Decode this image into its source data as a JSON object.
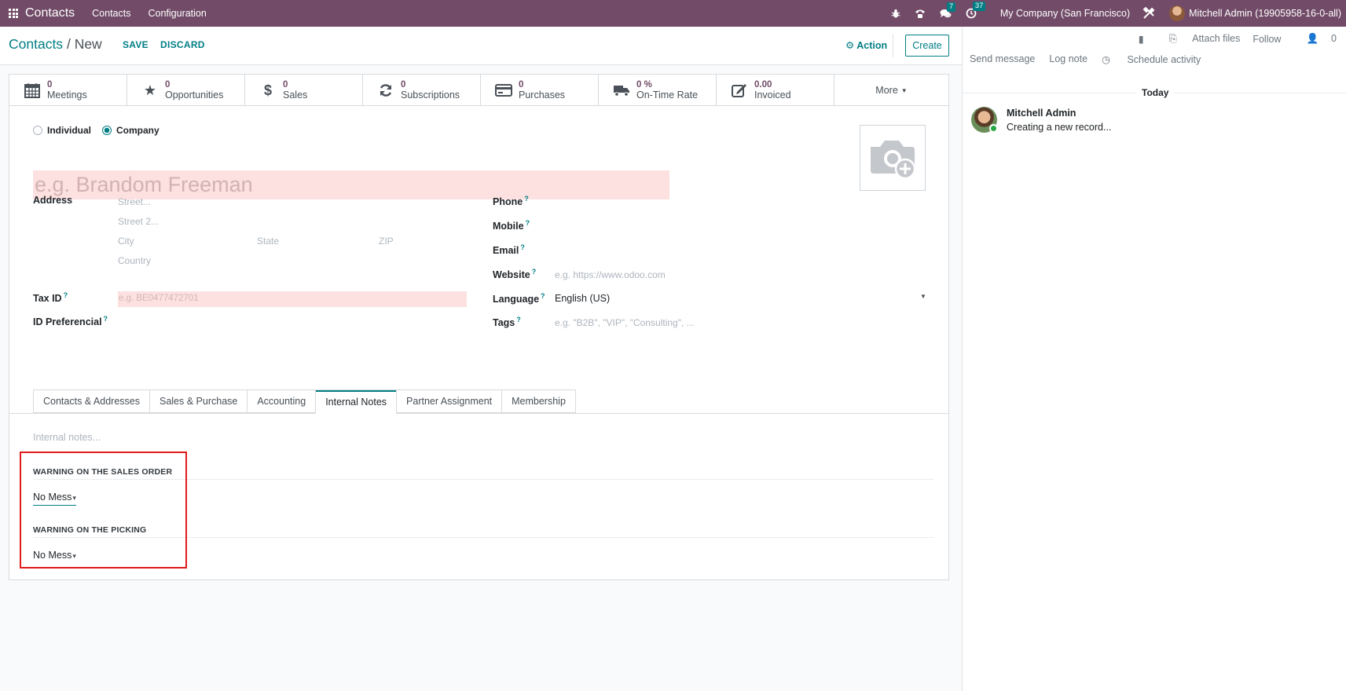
{
  "navbar": {
    "brand": "Contacts",
    "menus": [
      "Contacts",
      "Configuration"
    ],
    "messages_count": "7",
    "activities_count": "37",
    "company": "My Company (San Francisco)",
    "user": "Mitchell Admin (19905958-16-0-all)"
  },
  "control_panel": {
    "breadcrumb_root": "Contacts",
    "breadcrumb_sep": "/",
    "breadcrumb_current": "New",
    "save_label": "SAVE",
    "discard_label": "DISCARD",
    "action_label": "Action",
    "create_label": "Create"
  },
  "stat_buttons": [
    {
      "value": "0",
      "label": "Meetings",
      "icon": "calendar-icon"
    },
    {
      "value": "0",
      "label": "Opportunities",
      "icon": "star-icon"
    },
    {
      "value": "0",
      "label": "Sales",
      "icon": "dollar-icon"
    },
    {
      "value": "0",
      "label": "Subscriptions",
      "icon": "refresh-icon"
    },
    {
      "value": "0",
      "label": "Purchases",
      "icon": "credit-card-icon"
    },
    {
      "value": "0 %",
      "label": "On-Time Rate",
      "icon": "truck-icon"
    },
    {
      "value": "0.00",
      "label": "Invoiced",
      "icon": "edit-icon"
    }
  ],
  "more_label": "More",
  "form": {
    "type_individual": "Individual",
    "type_company": "Company",
    "name_placeholder": "e.g. Brandom Freeman",
    "address_label": "Address",
    "street_ph": "Street...",
    "street2_ph": "Street 2...",
    "city_ph": "City",
    "state_ph": "State",
    "zip_ph": "ZIP",
    "country_ph": "Country",
    "taxid_label": "Tax ID",
    "taxid_ph": "e.g. BE0477472701",
    "idpref_label": "ID Preferencial",
    "phone_label": "Phone",
    "mobile_label": "Mobile",
    "email_label": "Email",
    "website_label": "Website",
    "website_ph": "e.g. https://www.odoo.com",
    "language_label": "Language",
    "language_value": "English (US)",
    "tags_label": "Tags",
    "tags_ph": "e.g. \"B2B\", \"VIP\", \"Consulting\", ...",
    "help_mark": "?"
  },
  "tabs": [
    "Contacts & Addresses",
    "Sales & Purchase",
    "Accounting",
    "Internal Notes",
    "Partner Assignment",
    "Membership"
  ],
  "notes": {
    "placeholder": "Internal notes...",
    "sales_warning_title": "WARNING ON THE SALES ORDER",
    "sales_warning_value": "No Mess",
    "picking_warning_title": "WARNING ON THE PICKING",
    "picking_warning_value": "No Mess"
  },
  "chatter": {
    "attach_label": "Attach files",
    "follow_label": "Follow",
    "followers_count": "0",
    "send_message": "Send message",
    "log_note": "Log note",
    "schedule_activity": "Schedule activity",
    "today": "Today",
    "author": "Mitchell Admin",
    "body": "Creating a new record..."
  },
  "colors": {
    "brand": "#714B67",
    "accent": "#017e84",
    "highlight_box": "#e11a1a"
  }
}
